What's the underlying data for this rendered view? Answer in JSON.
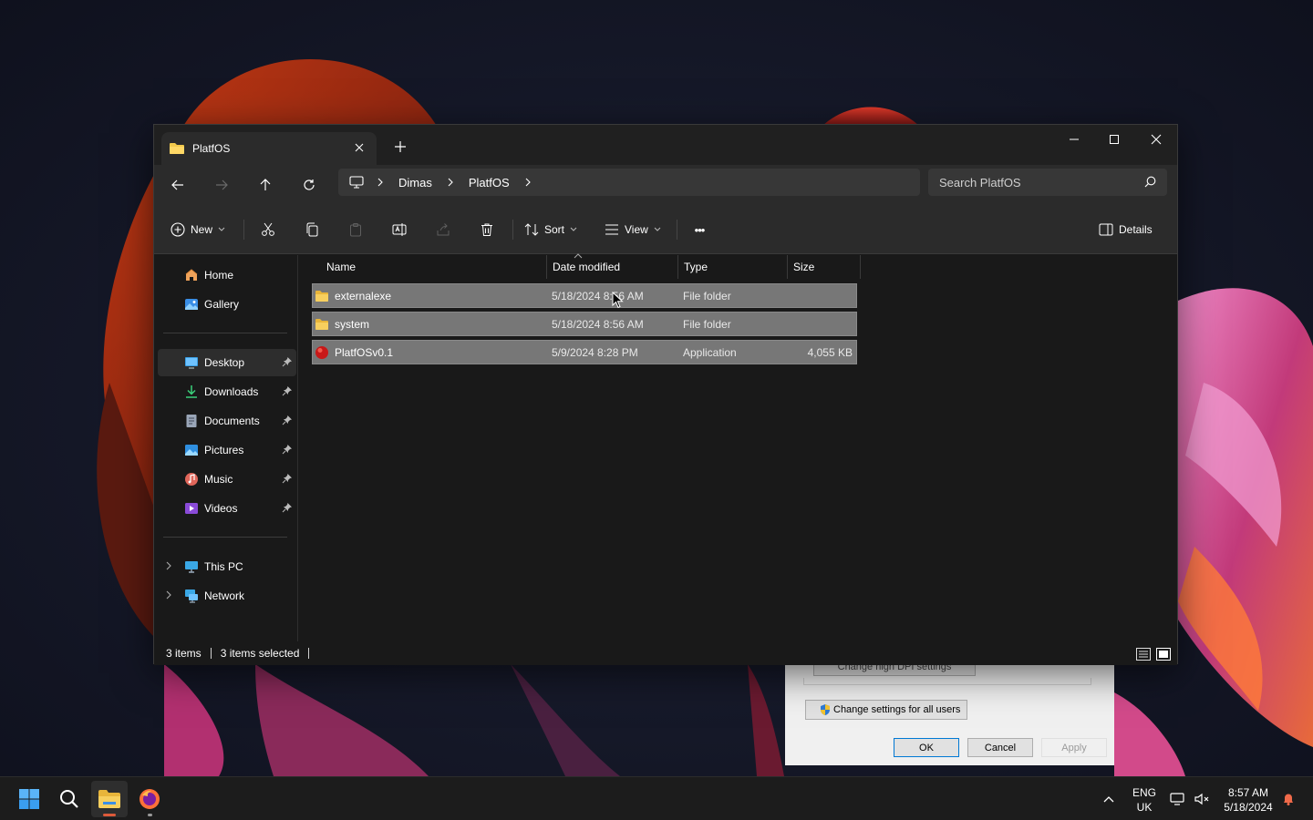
{
  "colors": {
    "window_bg": "#191919",
    "titlebar_bg": "#202020",
    "toolbar_bg": "#2b2b2b",
    "selection_row": "#777777",
    "folder_yellow": "#f2c94c",
    "accent_blue": "#4cc2ff"
  },
  "window": {
    "tab_title": "PlatfOS",
    "tab_icon": "folder-icon",
    "controls": {
      "minimize": "minimize-icon",
      "maximize": "maximize-icon",
      "close": "close-icon"
    }
  },
  "address": {
    "breadcrumbs": [
      "Dimas",
      "PlatfOS"
    ],
    "search_placeholder": "Search PlatfOS"
  },
  "commands": {
    "new_label": "New",
    "sort_label": "Sort",
    "view_label": "View",
    "more_label": "•••",
    "details_label": "Details"
  },
  "sidebar": {
    "top": [
      {
        "label": "Home",
        "icon": "home-icon"
      },
      {
        "label": "Gallery",
        "icon": "gallery-icon"
      }
    ],
    "quick": [
      {
        "label": "Desktop",
        "icon": "desktop-icon",
        "pinned": true,
        "active": true
      },
      {
        "label": "Downloads",
        "icon": "download-icon",
        "pinned": true
      },
      {
        "label": "Documents",
        "icon": "document-icon",
        "pinned": true
      },
      {
        "label": "Pictures",
        "icon": "pictures-icon",
        "pinned": true
      },
      {
        "label": "Music",
        "icon": "music-icon",
        "pinned": true
      },
      {
        "label": "Videos",
        "icon": "videos-icon",
        "pinned": true
      }
    ],
    "bottom": [
      {
        "label": "This PC",
        "icon": "computer-icon"
      },
      {
        "label": "Network",
        "icon": "network-icon"
      }
    ]
  },
  "filelist": {
    "columns": [
      "Name",
      "Date modified",
      "Type",
      "Size"
    ],
    "rows": [
      {
        "name": "externalexe",
        "date": "5/18/2024 8:56 AM",
        "type": "File folder",
        "size": "",
        "icon": "folder-icon"
      },
      {
        "name": "system",
        "date": "5/18/2024 8:56 AM",
        "type": "File folder",
        "size": "",
        "icon": "folder-icon"
      },
      {
        "name": "PlatfOSv0.1",
        "date": "5/9/2024 8:28 PM",
        "type": "Application",
        "size": "4,055 KB",
        "icon": "app-icon"
      }
    ]
  },
  "status": {
    "items": "3 items",
    "selected": "3 items selected"
  },
  "dialog": {
    "dpi_button": "Change high DPI settings",
    "all_users_button": "Change settings for all users",
    "ok": "OK",
    "cancel": "Cancel",
    "apply": "Apply"
  },
  "taskbar": {
    "lang_line1": "ENG",
    "lang_line2": "UK",
    "time": "8:57 AM",
    "date": "5/18/2024"
  }
}
